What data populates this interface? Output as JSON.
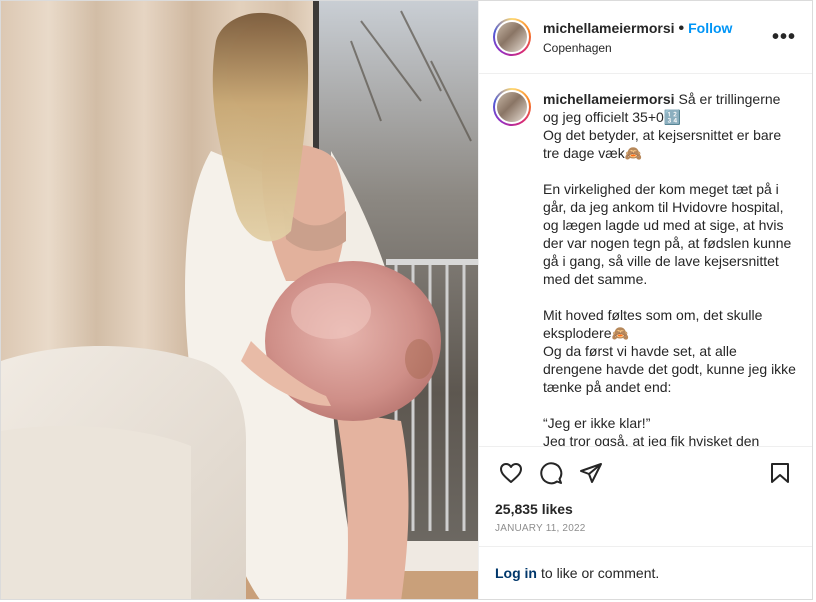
{
  "header": {
    "username": "michellameiermorsi",
    "separator": "•",
    "follow_label": "Follow",
    "location": "Copenhagen",
    "more_label": "•••"
  },
  "caption": {
    "username": "michellameiermorsi",
    "text": "Så er trillingerne og jeg officielt 35+0🔢\nOg det betyder, at kejsersnittet er bare tre dage væk🙈\n\nEn virkelighed der kom meget tæt på i går, da jeg ankom til Hvidovre hospital, og lægen lagde ud med at sige, at hvis der var nogen tegn på, at fødslen kunne gå i gang, så ville de lave kejsersnittet med det samme.\n\nMit hoved føltes som om, det skulle eksplodere🙈\nOg da først vi havde set, at alle drengene havde det godt, kunne jeg ikke tænke på andet end:\n\n“Jeg er ikke klar!”\nJeg tror også, at jeg fik hvisket den"
  },
  "icons": {
    "like": "heart-icon",
    "comment": "comment-icon",
    "share": "paper-plane-icon",
    "save": "bookmark-icon"
  },
  "stats": {
    "likes": "25,835 likes",
    "date": "JANUARY 11, 2022"
  },
  "footer": {
    "login_label": "Log in",
    "login_suffix": "to like or comment."
  }
}
